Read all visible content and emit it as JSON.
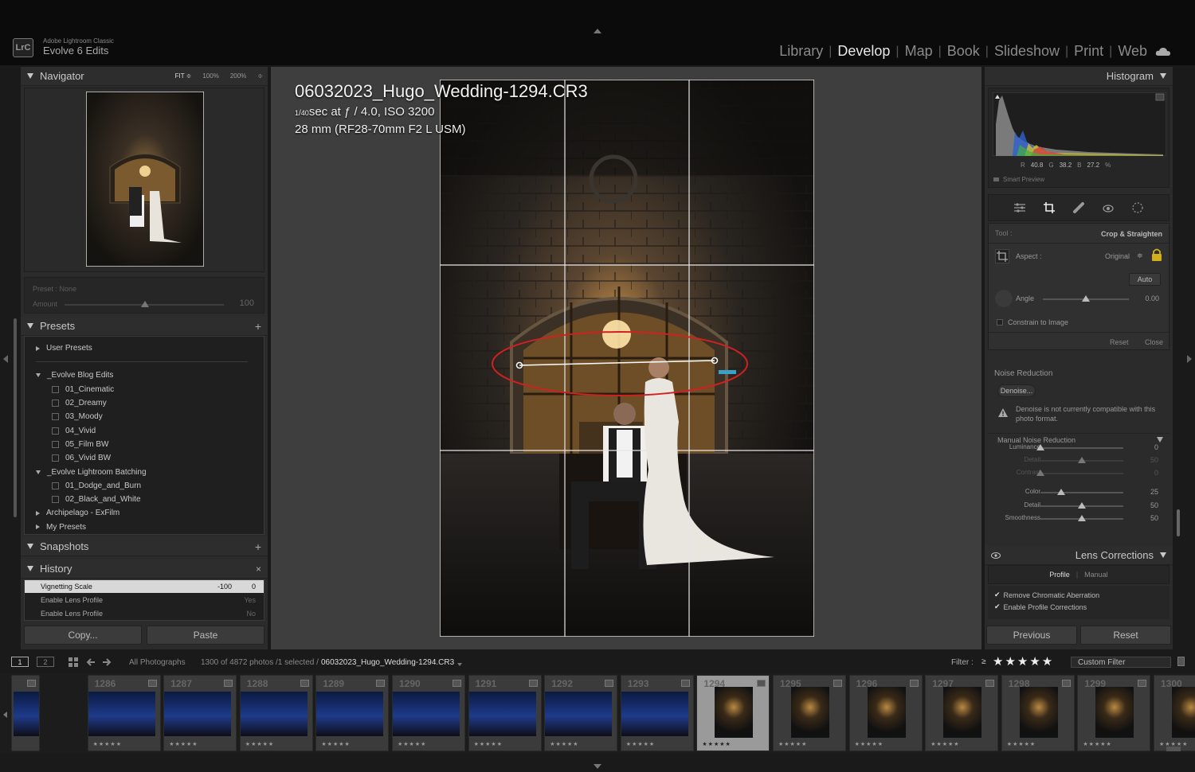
{
  "app": {
    "logo": "LrC",
    "name": "Adobe Lightroom Classic",
    "catalog": "Evolve 6 Edits"
  },
  "modules": {
    "items": [
      "Library",
      "Develop",
      "Map",
      "Book",
      "Slideshow",
      "Print",
      "Web"
    ],
    "active": "Develop"
  },
  "navigator": {
    "title": "Navigator",
    "zoom_fit": "FIT ≑",
    "zoom_100": "100%",
    "zoom_200": "200%",
    "zoom_more": "≑"
  },
  "quick_preset": {
    "preset_label": "Preset : None",
    "amount_label": "Amount",
    "amount_value": "100"
  },
  "presets": {
    "title": "Presets",
    "groups": [
      {
        "label": "User Presets",
        "expanded": false,
        "items": []
      },
      {
        "label": "_Evolve Blog Edits",
        "expanded": true,
        "items": [
          "01_Cinematic",
          "02_Dreamy",
          "03_Moody",
          "04_Vivid",
          "05_Film BW",
          "06_Vivid BW"
        ]
      },
      {
        "label": "_Evolve Lightroom Batching",
        "expanded": true,
        "items": [
          "01_Dodge_and_Burn",
          "02_Black_and_White"
        ]
      },
      {
        "label": "Archipelago - ExFilm",
        "expanded": false,
        "items": []
      },
      {
        "label": "My Presets",
        "expanded": false,
        "items": []
      }
    ]
  },
  "snapshots": {
    "title": "Snapshots"
  },
  "history": {
    "title": "History",
    "rows": [
      {
        "label": "Vignetting Scale",
        "from": "-100",
        "to": "0",
        "selected": true
      },
      {
        "label": "Enable Lens Profile",
        "from": "",
        "to": "Yes",
        "selected": false
      },
      {
        "label": "Enable Lens Profile",
        "from": "",
        "to": "No",
        "selected": false
      }
    ]
  },
  "left_buttons": {
    "copy": "Copy...",
    "paste": "Paste"
  },
  "photo_info": {
    "filename": "06032023_Hugo_Wedding-1294.CR3",
    "exposure_num": "1",
    "exposure_den": "40",
    "exposure_rest": " sec at ƒ / 4.0, ISO 3200",
    "lens": "28 mm (RF28-70mm F2 L USM)"
  },
  "histogram": {
    "title": "Histogram",
    "r_label": "R",
    "r": "40.8",
    "g_label": "G",
    "g": "38.2",
    "b_label": "B",
    "b": "27.2",
    "pct": "%",
    "smart_preview": "Smart Preview"
  },
  "crop": {
    "tool_label": "Tool :",
    "tool_value": "Crop & Straighten",
    "aspect_label": "Aspect :",
    "aspect_value": "Original",
    "aspect_arrow": "≑",
    "auto": "Auto",
    "angle_label": "Angle",
    "angle_value": "0.00",
    "angle_position": 0.5,
    "constrain_label": "Constrain to Image",
    "reset": "Reset",
    "close": "Close"
  },
  "noise": {
    "title": "Noise Reduction",
    "denoise": "Denoise...",
    "warning": "Denoise is not currently compatible with this photo format.",
    "manual_title": "Manual Noise Reduction",
    "sliders": [
      {
        "label": "Luminance",
        "value": "0",
        "pos": 0.0,
        "dim": false
      },
      {
        "label": "Detail",
        "value": "50",
        "pos": 0.5,
        "dim": true
      },
      {
        "label": "Contrast",
        "value": "0",
        "pos": 0.0,
        "dim": true
      },
      {
        "label": "Color",
        "value": "25",
        "pos": 0.25,
        "dim": false
      },
      {
        "label": "Detail",
        "value": "50",
        "pos": 0.5,
        "dim": false
      },
      {
        "label": "Smoothness",
        "value": "50",
        "pos": 0.5,
        "dim": false
      }
    ]
  },
  "lens": {
    "title": "Lens Corrections",
    "tab_profile": "Profile",
    "tab_manual": "Manual",
    "remove_ca": "Remove Chromatic Aberration",
    "enable_profile": "Enable Profile Corrections"
  },
  "right_buttons": {
    "previous": "Previous",
    "reset": "Reset"
  },
  "filmbar": {
    "screen1": "1",
    "screen2": "2",
    "source": "All Photographs",
    "count": "1300 of 4872 photos /1 selected /",
    "current_file": "06032023_Hugo_Wedding-1294.CR3",
    "filter_label": "Filter :",
    "filter_op": "≥",
    "filter_stars": "★★★★★",
    "custom_filter": "Custom Filter"
  },
  "filmstrip": {
    "thumbs": [
      {
        "num": "",
        "type": "group",
        "stars": "",
        "selected": false
      },
      {
        "num": "1286",
        "type": "group",
        "stars": "★★★★★",
        "selected": false
      },
      {
        "num": "1287",
        "type": "group",
        "stars": "★★★★★",
        "selected": false
      },
      {
        "num": "1288",
        "type": "group",
        "stars": "★★★★★",
        "selected": false
      },
      {
        "num": "1289",
        "type": "group",
        "stars": "★★★★★",
        "selected": false
      },
      {
        "num": "1290",
        "type": "group",
        "stars": "★★★★★",
        "selected": false
      },
      {
        "num": "1291",
        "type": "group",
        "stars": "★★★★★",
        "selected": false
      },
      {
        "num": "1292",
        "type": "group",
        "stars": "★★★★★",
        "selected": false
      },
      {
        "num": "1293",
        "type": "group",
        "stars": "★★★★★",
        "selected": false
      },
      {
        "num": "1294",
        "type": "night",
        "stars": "★★★★★",
        "selected": true
      },
      {
        "num": "1295",
        "type": "night",
        "stars": "★★★★★",
        "selected": false
      },
      {
        "num": "1296",
        "type": "night",
        "stars": "★★★★★",
        "selected": false
      },
      {
        "num": "1297",
        "type": "night",
        "stars": "★★★★★",
        "selected": false
      },
      {
        "num": "1298",
        "type": "night",
        "stars": "★★★★★",
        "selected": false
      },
      {
        "num": "1299",
        "type": "night",
        "stars": "★★★★★",
        "selected": false
      },
      {
        "num": "1300",
        "type": "night",
        "stars": "★★★★★",
        "selected": false
      }
    ]
  },
  "colors": {
    "accent_annotation": "#d02020",
    "selected_row": "#d8d8d8",
    "panel_bg": "#2b2b2b",
    "center_bg": "#3e3e3e"
  }
}
